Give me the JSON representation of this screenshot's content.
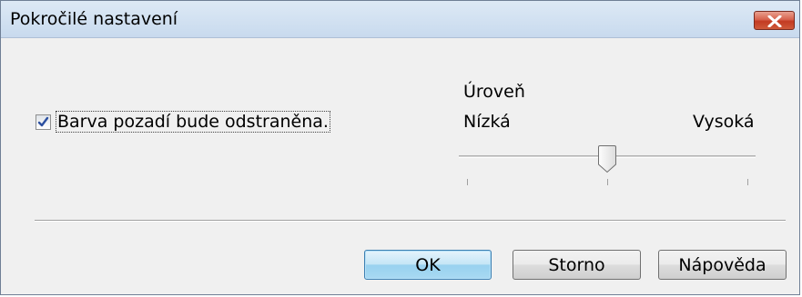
{
  "window": {
    "title": "Pokročilé nastavení"
  },
  "background_removal": {
    "checked": true,
    "label": "Barva pozadí bude odstraněna."
  },
  "level": {
    "label": "Úroveň",
    "low_label": "Nízká",
    "high_label": "Vysoká",
    "slider_value": 0.5,
    "tick_count": 3
  },
  "buttons": {
    "ok": "OK",
    "cancel": "Storno",
    "help": "Nápověda"
  },
  "colors": {
    "close_button": "#c94a30",
    "default_button": "#3c7fb1",
    "checkmark": "#2b4fa0"
  }
}
